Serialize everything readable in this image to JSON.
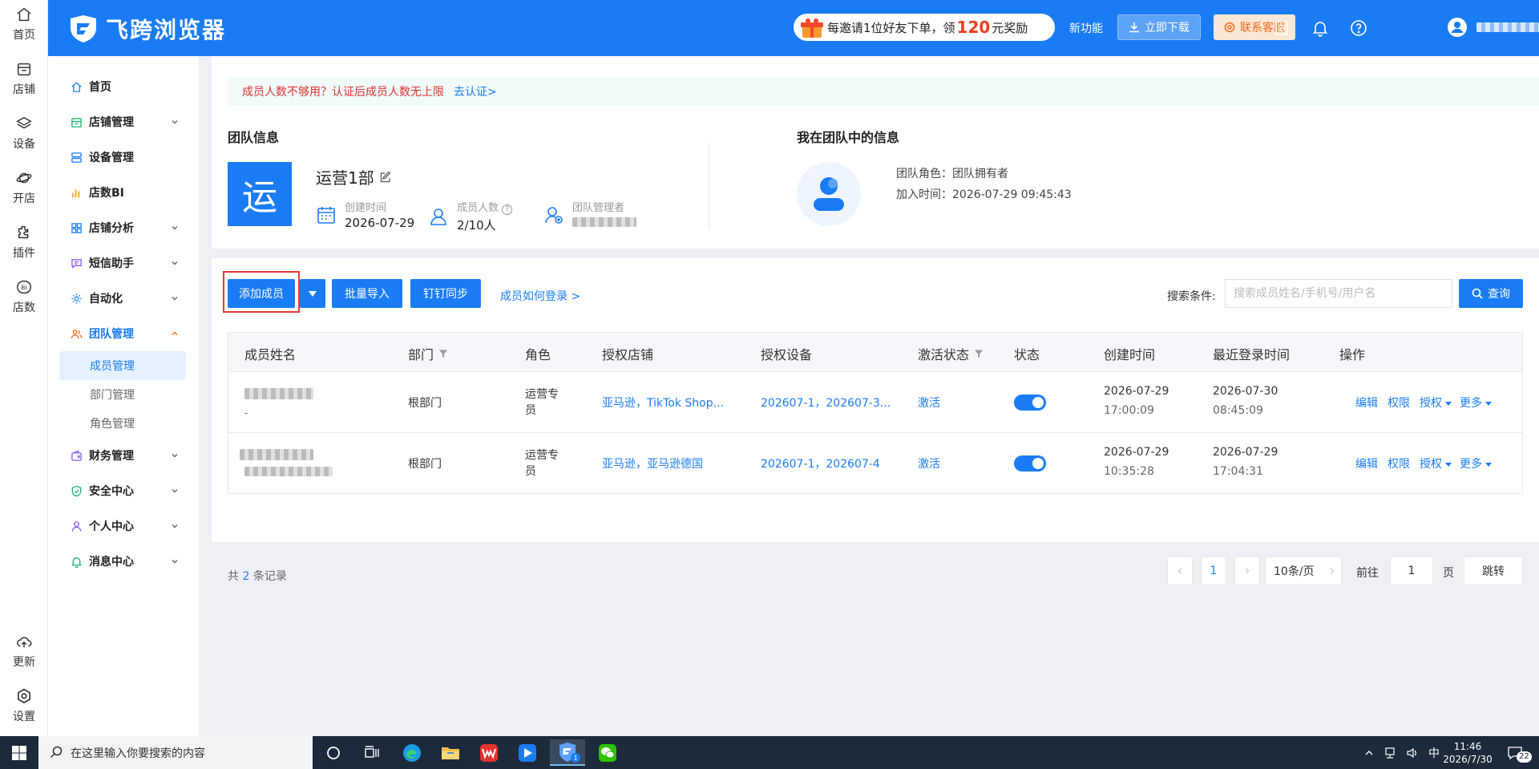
{
  "rail": {
    "items": [
      {
        "label": "首页",
        "icon": "home-icon"
      },
      {
        "label": "店铺",
        "icon": "store-icon"
      },
      {
        "label": "设备",
        "icon": "layers-icon"
      },
      {
        "label": "开店",
        "icon": "planet-icon"
      },
      {
        "label": "插件",
        "icon": "puzzle-icon"
      },
      {
        "label": "店数",
        "icon": "bi-icon"
      }
    ],
    "bottom": [
      {
        "label": "更新",
        "icon": "cloud-upload-icon"
      },
      {
        "label": "设置",
        "icon": "gear-icon"
      }
    ]
  },
  "header": {
    "logo_text": "飞跨浏览器",
    "invite_prefix": "每邀请1位好友下单，领",
    "invite_amount": "120",
    "invite_suffix": "元奖励",
    "new_feature": "新功能",
    "download": "立即下载",
    "contact": "联系客服",
    "colors": {
      "brand": "#1a7cf5",
      "contact_text": "#f06a1a",
      "contact_bg": "#fbe7d5"
    }
  },
  "sidebar": {
    "items": [
      {
        "label": "首页"
      },
      {
        "label": "店铺管理"
      },
      {
        "label": "设备管理"
      },
      {
        "label": "店数BI"
      },
      {
        "label": "店铺分析"
      },
      {
        "label": "短信助手"
      },
      {
        "label": "自动化"
      },
      {
        "label": "团队管理"
      },
      {
        "label": "财务管理"
      },
      {
        "label": "安全中心"
      },
      {
        "label": "个人中心"
      },
      {
        "label": "消息中心"
      }
    ],
    "team_sub": [
      {
        "label": "成员管理"
      },
      {
        "label": "部门管理"
      },
      {
        "label": "角色管理"
      }
    ]
  },
  "notice": {
    "text": "成员人数不够用？认证后成员人数无上限",
    "link": "去认证>"
  },
  "team": {
    "section_title": "团队信息",
    "avatar_char": "运",
    "name": "运营1部",
    "created_label": "创建时间",
    "created_value": "2026-07-29",
    "members_label": "成员人数",
    "members_value": "2/10人",
    "manager_label": "团队管理者"
  },
  "me": {
    "section_title": "我在团队中的信息",
    "role_label": "团队角色：",
    "role_value": "团队拥有者",
    "join_label": "加入时间：",
    "join_value": "2026-07-29 09:45:43"
  },
  "toolbar": {
    "add_member": "添加成员",
    "batch_import": "批量导入",
    "dingtalk_sync": "钉钉同步",
    "how_login": "成员如何登录 >",
    "search_label": "搜索条件:",
    "search_placeholder": "搜索成员姓名/手机号/用户名",
    "query": "查询"
  },
  "table": {
    "columns": [
      "成员姓名",
      "部门",
      "角色",
      "授权店铺",
      "授权设备",
      "激活状态",
      "状态",
      "创建时间",
      "最近登录时间",
      "操作"
    ],
    "rows": [
      {
        "name_sub": "-",
        "dept": "根部门",
        "role_line1": "运营专",
        "role_line2": "员",
        "shops": "亚马逊，TikTok Shop...",
        "devices": "202607-1，202607-3...",
        "activation": "激活",
        "status_on": true,
        "created_date": "2026-07-29",
        "created_time": "17:00:09",
        "login_date": "2026-07-30",
        "login_time": "08:45:09",
        "actions": [
          "编辑",
          "权限",
          "授权",
          "更多"
        ]
      },
      {
        "name_sub": "",
        "dept": "根部门",
        "role_line1": "运营专",
        "role_line2": "员",
        "shops": "亚马逊，亚马逊德国",
        "devices": "202607-1，202607-4",
        "activation": "激活",
        "status_on": true,
        "created_date": "2026-07-29",
        "created_time": "10:35:28",
        "login_date": "2026-07-29",
        "login_time": "17:04:31",
        "actions": [
          "编辑",
          "权限",
          "授权",
          "更多"
        ]
      }
    ]
  },
  "pagination": {
    "total_prefix": "共",
    "total_count": "2",
    "total_suffix": "条记录",
    "current_page": "1",
    "page_size": "10条/页",
    "goto_label": "前往",
    "goto_value": "1",
    "page_unit": "页",
    "jump": "跳转"
  },
  "taskbar": {
    "search_placeholder": "在这里输入你要搜索的内容",
    "ime": "中",
    "time": "11:46",
    "date": "2026/7/30",
    "notif_count": "22",
    "app_badge": "1"
  }
}
